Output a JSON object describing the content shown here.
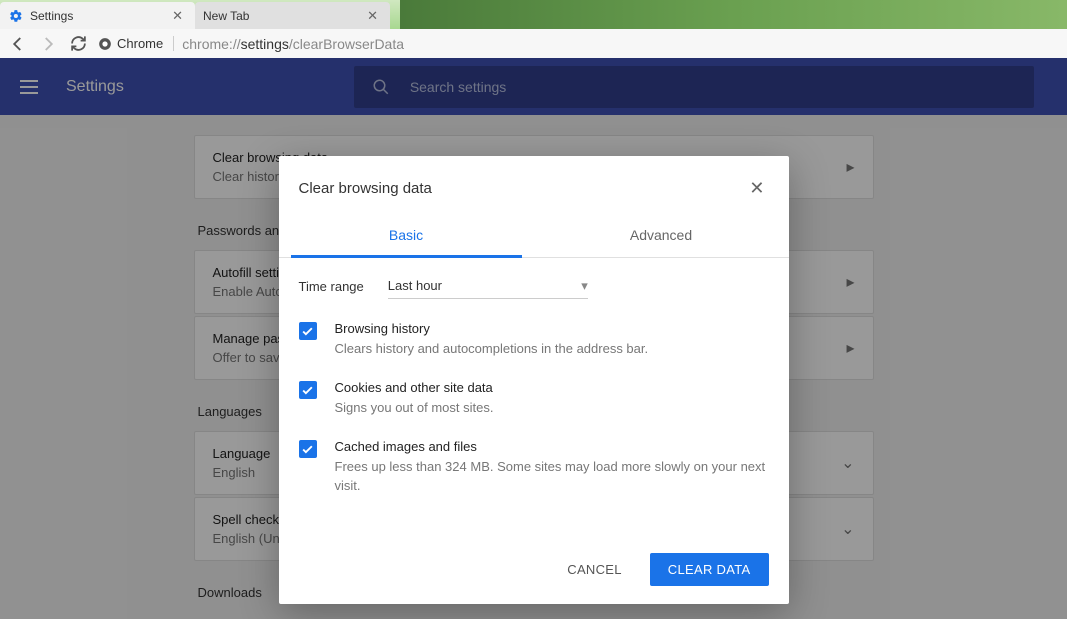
{
  "tabs": [
    {
      "title": "Settings"
    },
    {
      "title": "New Tab"
    }
  ],
  "address": {
    "badge": "Chrome",
    "url_prefix": "chrome://",
    "url_bold": "settings",
    "url_suffix": "/clearBrowserData"
  },
  "app": {
    "title": "Settings",
    "search_placeholder": "Search settings"
  },
  "sections": {
    "privacy": {
      "clear": {
        "title": "Clear browsing data",
        "sub": "Clear history, cookies, cache, and more"
      }
    },
    "passwords": {
      "label": "Passwords and forms",
      "autofill": {
        "title": "Autofill settings",
        "sub": "Enable Autofill to fill out forms in a single click"
      },
      "manage": {
        "title": "Manage passwords",
        "sub": "Offer to save your web passwords"
      }
    },
    "languages": {
      "label": "Languages",
      "language": {
        "title": "Language",
        "sub": "English"
      },
      "spell": {
        "title": "Spell check",
        "sub": "English (United States)"
      }
    },
    "downloads": {
      "label": "Downloads"
    }
  },
  "dialog": {
    "title": "Clear browsing data",
    "tab_basic": "Basic",
    "tab_advanced": "Advanced",
    "time_label": "Time range",
    "time_value": "Last hour",
    "items": [
      {
        "title": "Browsing history",
        "desc": "Clears history and autocompletions in the address bar."
      },
      {
        "title": "Cookies and other site data",
        "desc": "Signs you out of most sites."
      },
      {
        "title": "Cached images and files",
        "desc": "Frees up less than 324 MB. Some sites may load more slowly on your next visit."
      }
    ],
    "cancel": "CANCEL",
    "clear": "CLEAR DATA"
  }
}
